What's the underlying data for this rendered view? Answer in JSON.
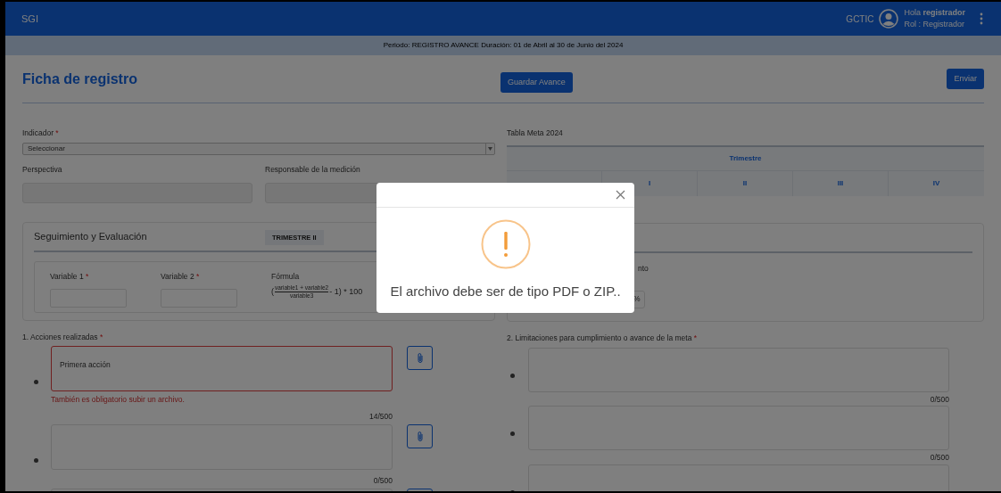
{
  "header": {
    "app_name": "SGI",
    "org": "GCTIC",
    "greeting": "Hola **registrador**",
    "role": "Rol : Registrador"
  },
  "period_banner": "Periodo: REGISTRO AVANCE Duración: 01 de Abril al 30 de Junio del 2024",
  "page": {
    "title": "Ficha de registro",
    "save_button": "Guardar Avance",
    "send_button": "Enviar"
  },
  "indicador": {
    "label": "Indicador",
    "required_mark": "*",
    "value": "Seleccionar"
  },
  "fields": [
    {
      "label": "Perspectiva"
    },
    {
      "label": "Responsable de la medición"
    }
  ],
  "meta_table": {
    "title": "Tabla Meta 2024",
    "group_header": "Trimestre",
    "columns": [
      "I",
      "II",
      "III",
      "IV"
    ]
  },
  "seguimiento": {
    "title": "Seguimiento y Evaluación",
    "badge": "TRIMESTRE II",
    "variables": [
      {
        "label": "Variable 1",
        "required_mark": "*"
      },
      {
        "label": "Variable 2",
        "required_mark": "*"
      }
    ],
    "formula": {
      "label": "Fórmula",
      "prefix": "(",
      "numerator": "variable1 + variable2",
      "denominator": "variable3",
      "suffix": "- 1) * 100"
    }
  },
  "right_card": {
    "partial_label": "nto",
    "partial_unit": "%"
  },
  "acciones": {
    "title": "1. Acciones realizadas",
    "required_mark": "*",
    "items": [
      {
        "value": "Primera acción",
        "invalid": true,
        "error": "También es obligatorio subir un archivo.",
        "counter": "14/500"
      },
      {
        "invalid": false,
        "counter": "0/500"
      },
      {
        "invalid": false
      }
    ]
  },
  "limitaciones": {
    "title": "2. Limitaciones para cumplimiento o avance de la meta",
    "required_mark": "*",
    "items": [
      {
        "invalid": false,
        "counter": "0/500"
      },
      {
        "invalid": false,
        "counter": "0/500"
      },
      {
        "invalid": false
      }
    ]
  },
  "modal": {
    "message": "El archivo debe ser de tipo PDF o ZIP.."
  }
}
